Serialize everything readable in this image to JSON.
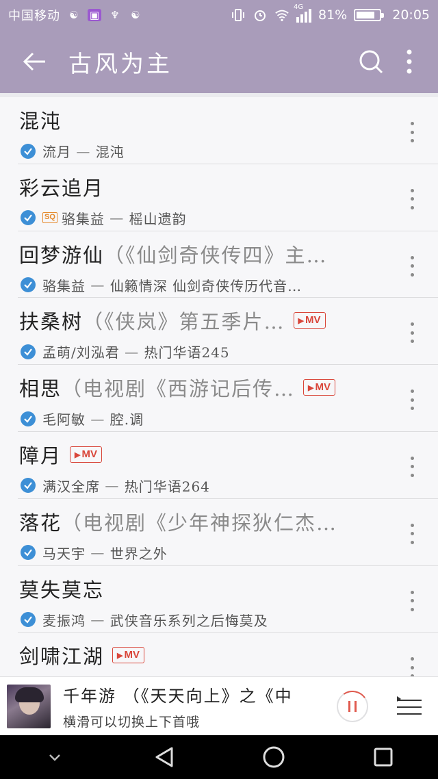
{
  "status_bar": {
    "carrier": "中国移动",
    "network": "4G",
    "battery_percent_text": "81%",
    "battery_level": 0.81,
    "time": "20:05"
  },
  "app_bar": {
    "title": "古风为主",
    "back_icon": "arrow-left-icon",
    "search_icon": "search-icon",
    "more_icon": "more-vertical-icon"
  },
  "songs": [
    {
      "title": "混沌",
      "title_extra": "",
      "mv": false,
      "sq": false,
      "artist": "流月",
      "sep": " — ",
      "album": "混沌"
    },
    {
      "title": "彩云追月",
      "title_extra": "",
      "mv": false,
      "sq": true,
      "artist": "骆集益",
      "sep": " — ",
      "album": "榣山遗韵"
    },
    {
      "title": "回梦游仙",
      "title_extra": "（《仙剑奇侠传四》主…",
      "mv": false,
      "sq": false,
      "artist": "骆集益",
      "sep": " — ",
      "album": "仙籁情深 仙剑奇侠传历代音…"
    },
    {
      "title": "扶桑树",
      "title_extra": "（《侠岚》第五季片…",
      "mv": true,
      "sq": false,
      "artist": "孟萌/刘泓君",
      "sep": " — ",
      "album": "热门华语245"
    },
    {
      "title": "相思",
      "title_extra": "（电视剧《西游记后传…",
      "mv": true,
      "sq": false,
      "artist": "毛阿敏",
      "sep": " — ",
      "album": "腔.调"
    },
    {
      "title": "障月",
      "title_extra": "",
      "mv": true,
      "sq": false,
      "artist": "满汉全席",
      "sep": " — ",
      "album": "热门华语264"
    },
    {
      "title": "落花",
      "title_extra": "（电视剧《少年神探狄仁杰…",
      "mv": false,
      "sq": false,
      "artist": "马天宇",
      "sep": " — ",
      "album": "世界之外"
    },
    {
      "title": "莫失莫忘",
      "title_extra": "",
      "mv": false,
      "sq": false,
      "artist": "麦振鸿",
      "sep": " — ",
      "album": "武侠音乐系列之后悔莫及"
    },
    {
      "title": "剑啸江湖",
      "title_extra": "",
      "mv": true,
      "sq": false,
      "artist": "",
      "sep": "",
      "album": ""
    }
  ],
  "badges": {
    "mv_label": "MV",
    "sq_label": "SQ"
  },
  "player": {
    "now_playing_title": "千年游 （《天天向上》之《中",
    "hint": "横滑可以切换上下首哦",
    "state": "playing",
    "progress_fraction": 0.08
  },
  "nav_bar": {
    "buttons": [
      "collapse-icon",
      "back-triangle-icon",
      "home-circle-icon",
      "recents-square-icon"
    ]
  },
  "colors": {
    "accent": "#a99cba",
    "check_blue": "#3d8fd6",
    "mv_red": "#d9463a",
    "sq_orange": "#e58a2d"
  }
}
